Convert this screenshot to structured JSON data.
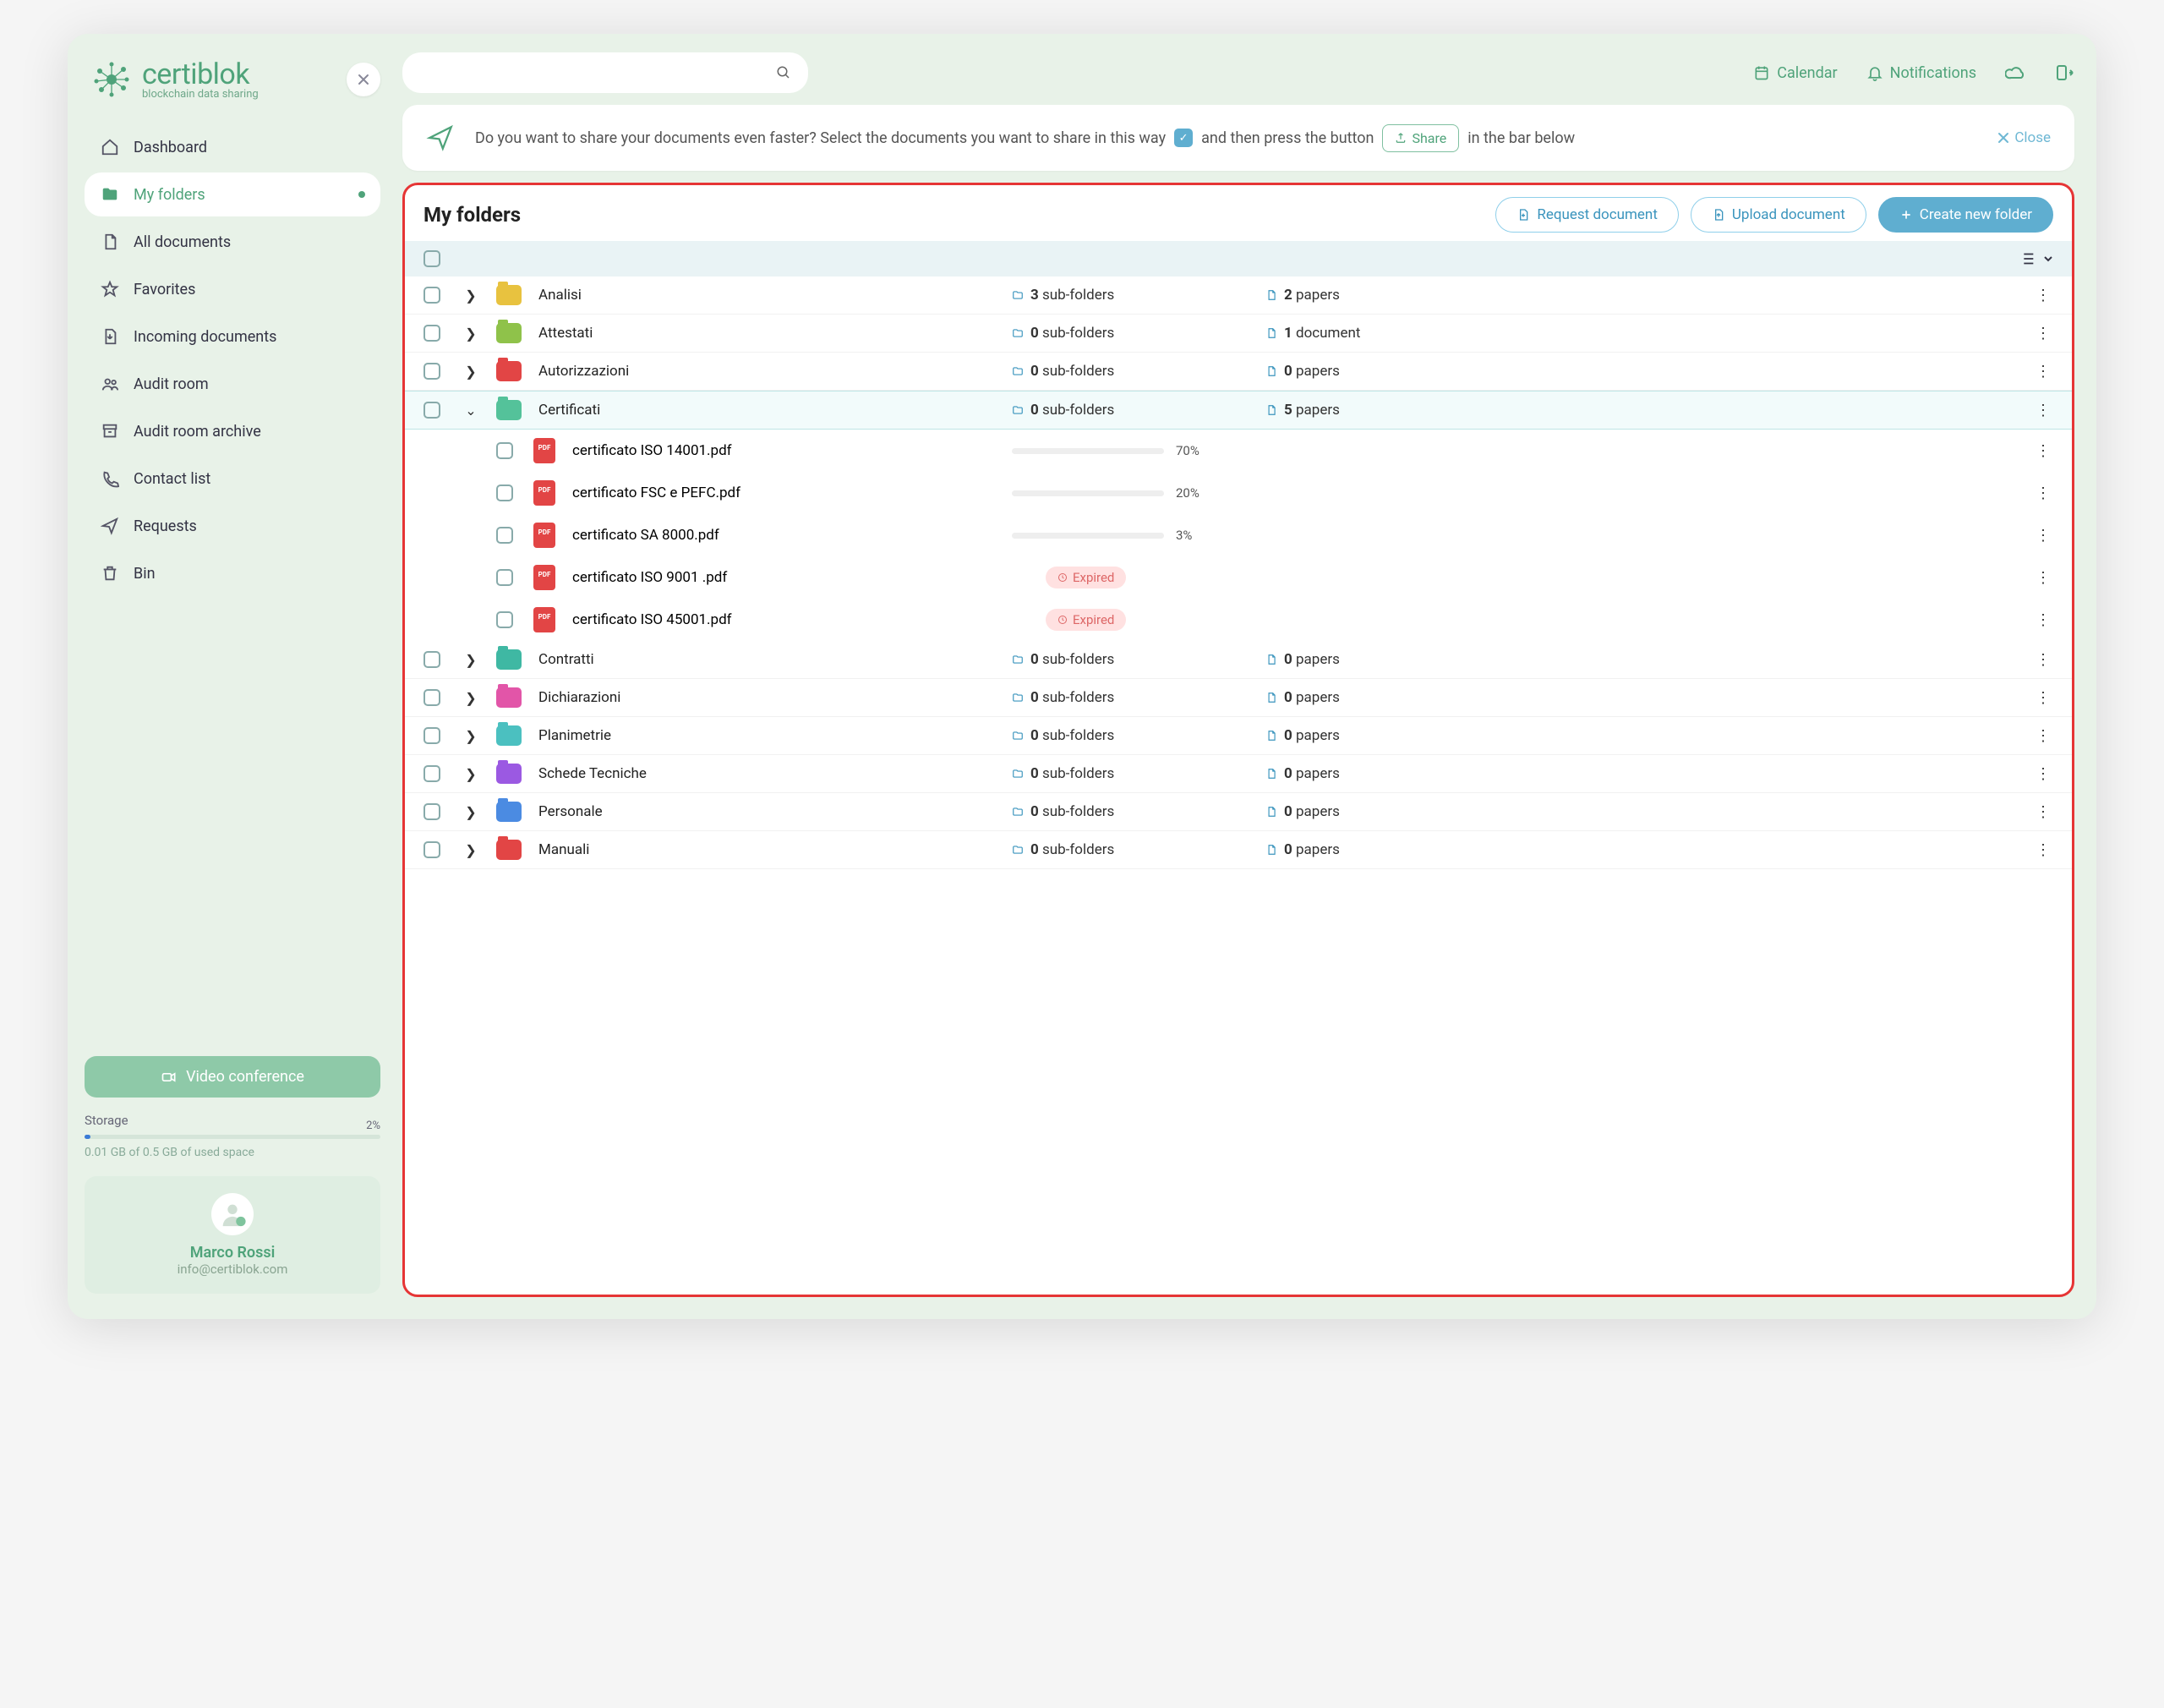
{
  "brand": {
    "name": "certiblok",
    "tagline": "blockchain data sharing"
  },
  "sidebar": {
    "items": [
      {
        "label": "Dashboard"
      },
      {
        "label": "My folders",
        "active": true
      },
      {
        "label": "All documents"
      },
      {
        "label": "Favorites"
      },
      {
        "label": "Incoming documents"
      },
      {
        "label": "Audit room"
      },
      {
        "label": "Audit room archive"
      },
      {
        "label": "Contact list"
      },
      {
        "label": "Requests"
      },
      {
        "label": "Bin"
      }
    ],
    "video_btn": "Video conference",
    "storage_label": "Storage",
    "storage_pct": "2%",
    "storage_text": "0.01 GB of 0.5 GB of used space",
    "user": {
      "name": "Marco Rossi",
      "email": "info@certiblok.com"
    }
  },
  "topbar": {
    "calendar": "Calendar",
    "notifications": "Notifications"
  },
  "banner": {
    "text_a": "Do you want to share your documents even faster? Select the documents you want to share in this way",
    "share": "Share",
    "text_b": "and then press the button",
    "text_c": "in the bar below",
    "close": "Close"
  },
  "content": {
    "title": "My folders",
    "actions": {
      "request": "Request document",
      "upload": "Upload document",
      "create": "Create new folder"
    },
    "subfolders_word": "sub-folders",
    "papers_word": "papers",
    "document_word": "document",
    "expired": "Expired",
    "folders": [
      {
        "name": "Analisi",
        "color": "#e8c23f",
        "sub": 3,
        "papers": 2,
        "papers_label": "papers"
      },
      {
        "name": "Attestati",
        "color": "#8fc24a",
        "sub": 0,
        "papers": 1,
        "papers_label": "document"
      },
      {
        "name": "Autorizzazioni",
        "color": "#e24545",
        "sub": 0,
        "papers": 0,
        "papers_label": "papers"
      },
      {
        "name": "Certificati",
        "color": "#54c29a",
        "sub": 0,
        "papers": 5,
        "papers_label": "papers",
        "open": true,
        "files": [
          {
            "name": "certificato ISO 14001.pdf",
            "pct": 70,
            "color": "#f0a92e"
          },
          {
            "name": "certificato FSC e PEFC.pdf",
            "pct": 20,
            "color": "#f05a2e"
          },
          {
            "name": "certificato SA 8000.pdf",
            "pct": 3,
            "color": "#f05a2e"
          },
          {
            "name": "certificato ISO 9001 .pdf",
            "expired": true
          },
          {
            "name": "certificato ISO 45001.pdf",
            "expired": true
          }
        ]
      },
      {
        "name": "Contratti",
        "color": "#3fb8a3",
        "sub": 0,
        "papers": 0,
        "papers_label": "papers"
      },
      {
        "name": "Dichiarazioni",
        "color": "#e255a8",
        "sub": 0,
        "papers": 0,
        "papers_label": "papers"
      },
      {
        "name": "Planimetrie",
        "color": "#4bc0c0",
        "sub": 0,
        "papers": 0,
        "papers_label": "papers"
      },
      {
        "name": "Schede Tecniche",
        "color": "#9b59e2",
        "sub": 0,
        "papers": 0,
        "papers_label": "papers"
      },
      {
        "name": "Personale",
        "color": "#4b8be2",
        "sub": 0,
        "papers": 0,
        "papers_label": "papers"
      },
      {
        "name": "Manuali",
        "color": "#e24545",
        "sub": 0,
        "papers": 0,
        "papers_label": "papers"
      }
    ]
  }
}
